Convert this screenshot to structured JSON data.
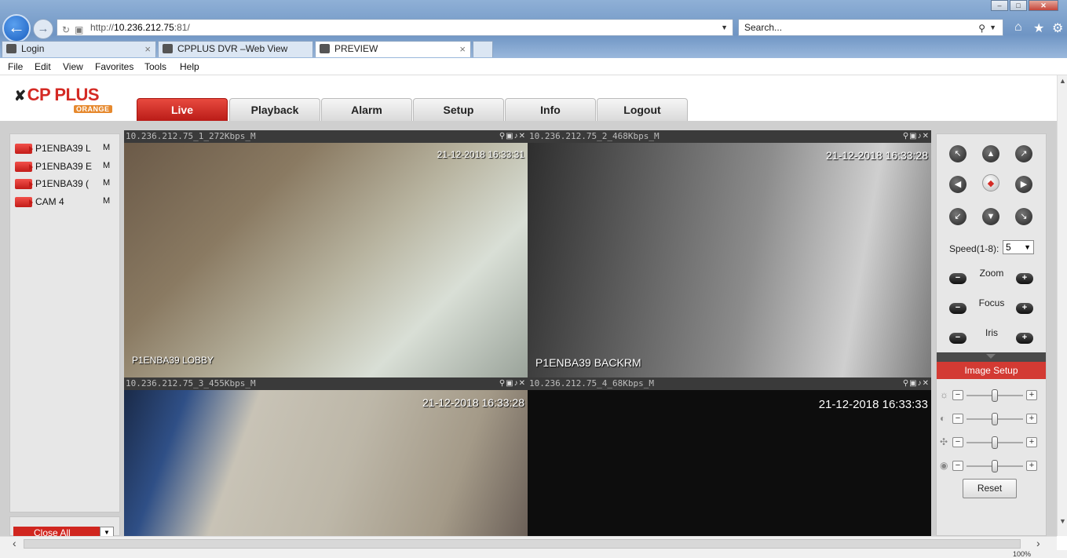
{
  "browser": {
    "address_prefix": "http://",
    "address_host": "10.236.212.75",
    "address_suffix": ":81/",
    "search_placeholder": "Search...",
    "tabs": [
      {
        "label": "Login"
      },
      {
        "label": "CPPLUS DVR –Web View"
      },
      {
        "label": "PREVIEW"
      }
    ],
    "menu": [
      "File",
      "Edit",
      "View",
      "Favorites",
      "Tools",
      "Help"
    ],
    "zoom": "100%"
  },
  "app": {
    "logo_text": "CP PLUS",
    "logo_sub": "ORANGE",
    "nav": [
      "Live",
      "Playback",
      "Alarm",
      "Setup",
      "Info",
      "Logout"
    ],
    "active_nav": "Live"
  },
  "cameras": [
    {
      "name": "P1ENBA39 L",
      "mode": "M"
    },
    {
      "name": "P1ENBA39 E",
      "mode": "M"
    },
    {
      "name": "P1ENBA39 (",
      "mode": "M"
    },
    {
      "name": "CAM 4",
      "mode": "M"
    }
  ],
  "close_all_label": "Close All",
  "views": [
    {
      "header": "10.236.212.75_1_272Kbps_M",
      "timestamp": "21-12-2018 16:33:31",
      "label": "P1ENBA39 LOBBY"
    },
    {
      "header": "10.236.212.75_2_468Kbps_M",
      "timestamp": "21-12-2018 16:33:28",
      "label": "P1ENBA39 BACKRM"
    },
    {
      "header": "10.236.212.75_3_455Kbps_M",
      "timestamp": "21-12-2018 16:33:28",
      "label": ""
    },
    {
      "header": "10.236.212.75_4_68Kbps_M",
      "timestamp": "21-12-2018 16:33:33",
      "label": ""
    }
  ],
  "ptz": {
    "speed_label": "Speed(1-8):",
    "speed_value": "5",
    "zoom_label": "Zoom",
    "focus_label": "Focus",
    "iris_label": "Iris",
    "image_setup_label": "Image Setup",
    "reset_label": "Reset",
    "sliders": [
      {
        "icon": "brightness-icon",
        "level": 0.5
      },
      {
        "icon": "contrast-icon",
        "level": 0.5
      },
      {
        "icon": "saturation-icon",
        "level": 0.5
      },
      {
        "icon": "hue-icon",
        "level": 0.5
      }
    ]
  },
  "colors": {
    "accent": "#d42a24",
    "selected_view": "#2f9a3a"
  }
}
